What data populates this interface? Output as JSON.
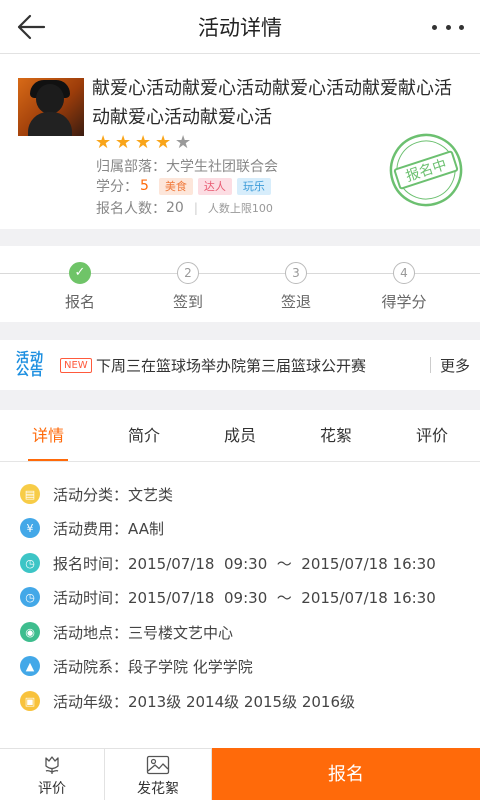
{
  "header": {
    "title": "活动详情",
    "back_icon": "arrow-left-icon",
    "more_icon": "more-dots-icon"
  },
  "activity": {
    "title": "献爱心活动献爱心活动献爱心活动献爱献心活动献爱心活动献爱心活",
    "rating": 4,
    "rating_max": 5,
    "department_label": "归属部落：",
    "department": "大学生社团联合会",
    "credit_label": "学分：",
    "credit": "5",
    "tags": [
      "美食",
      "达人",
      "玩乐"
    ],
    "count_label": "报名人数：",
    "count": "20",
    "count_separator": "|",
    "count_limit": "人数上限100",
    "stamp_text": "报名中",
    "colors": {
      "accent": "#ff6a0a",
      "stamp": "#6cc070",
      "star": "#f9a51a"
    }
  },
  "progress": {
    "steps": [
      {
        "index": "✓",
        "label": "报名"
      },
      {
        "index": "2",
        "label": "签到"
      },
      {
        "index": "3",
        "label": "签退"
      },
      {
        "index": "4",
        "label": "得学分"
      }
    ],
    "current": 1
  },
  "notice": {
    "logo_line1": "活动",
    "logo_line2": "公告",
    "badge": "NEW",
    "text": "下周三在篮球场举办院第三届篮球公开赛",
    "more": "更多"
  },
  "tabs": {
    "items": [
      "详情",
      "简介",
      "成员",
      "花絮",
      "评价"
    ],
    "active": 0
  },
  "details": [
    {
      "label": "活动分类：",
      "value": "文艺类",
      "icon": "category-icon"
    },
    {
      "label": "活动费用：",
      "value": "AA制",
      "icon": "money-icon"
    },
    {
      "label": "报名时间：",
      "value": "2015/07/18  09:30  ～  2015/07/18 16:30",
      "icon": "clock-icon"
    },
    {
      "label": "活动时间：",
      "value": "2015/07/18  09:30  ～  2015/07/18 16:30",
      "icon": "clock-icon"
    },
    {
      "label": "活动地点：",
      "value": "三号楼文艺中心",
      "icon": "location-icon"
    },
    {
      "label": "活动院系：",
      "value": "段子学院 化学学院",
      "icon": "faculty-icon"
    },
    {
      "label": "活动年级：",
      "value": "2013级 2014级 2015级 2016级",
      "icon": "grade-icon"
    }
  ],
  "bottom_bar": {
    "rate": "评价",
    "photo": "发花絮",
    "signup": "报名"
  }
}
